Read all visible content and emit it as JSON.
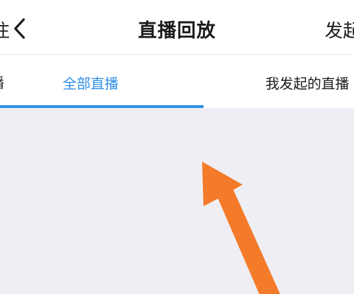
{
  "header": {
    "left_edge_text": "注",
    "title": "直播回放",
    "action_label": "发起"
  },
  "tabs": {
    "left_edge_label": "播",
    "items": [
      {
        "label": "全部直播",
        "active": true
      },
      {
        "label": "我发起的直播",
        "active": false
      }
    ]
  },
  "colors": {
    "accent": "#2f8fe6",
    "background": "#efeef4",
    "annotation_arrow": "#f47b2a"
  },
  "icons": {
    "back": "chevron-left-icon"
  }
}
